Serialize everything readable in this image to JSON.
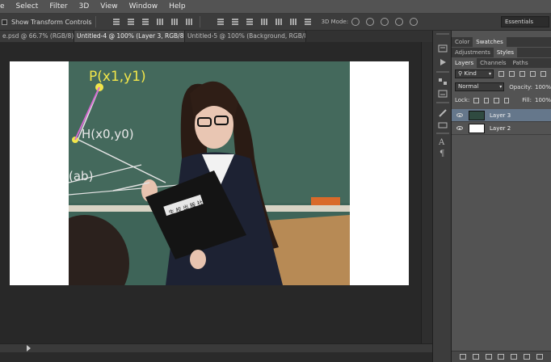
{
  "menu": [
    "e",
    "Select",
    "Filter",
    "3D",
    "View",
    "Window",
    "Help"
  ],
  "options": {
    "show_transform_label": "Show Transform Controls",
    "mode_3d_label": "3D Mode:",
    "workspace": "Essentials"
  },
  "tabs": [
    {
      "label": "e.psd @ 66.7% (RGB/8) *",
      "active": false
    },
    {
      "label": "Untitled-4 @ 100% (Layer 3, RGB/8) *",
      "active": true
    },
    {
      "label": "Untitled-5 @ 100% (Background, RGB/8) *",
      "active": false
    }
  ],
  "canvas": {
    "photo_text": {
      "p_label": "P(x1,y1)",
      "h_label": "H(x0,y0)",
      "ab_label": "(ab)",
      "book_label": "生 校 出 版 社"
    }
  },
  "panels": {
    "top_tabs": [
      "Color",
      "Swatches"
    ],
    "mid_tabs": [
      "Adjustments",
      "Styles"
    ],
    "layer_tabs": [
      "Layers",
      "Channels",
      "Paths"
    ],
    "kind_label": "Kind",
    "blend_mode": "Normal",
    "opacity_label": "Opacity:",
    "opacity_value": "100%",
    "lock_label": "Lock:",
    "fill_label": "Fill:",
    "fill_value": "100%",
    "layers": [
      {
        "name": "Layer 3",
        "selected": true
      },
      {
        "name": "Layer 2",
        "selected": false
      }
    ]
  },
  "colors": {
    "menubar": "#535353",
    "panel": "#535353",
    "selected_layer": "#65778b",
    "chalkboard": "#3a5a50"
  }
}
